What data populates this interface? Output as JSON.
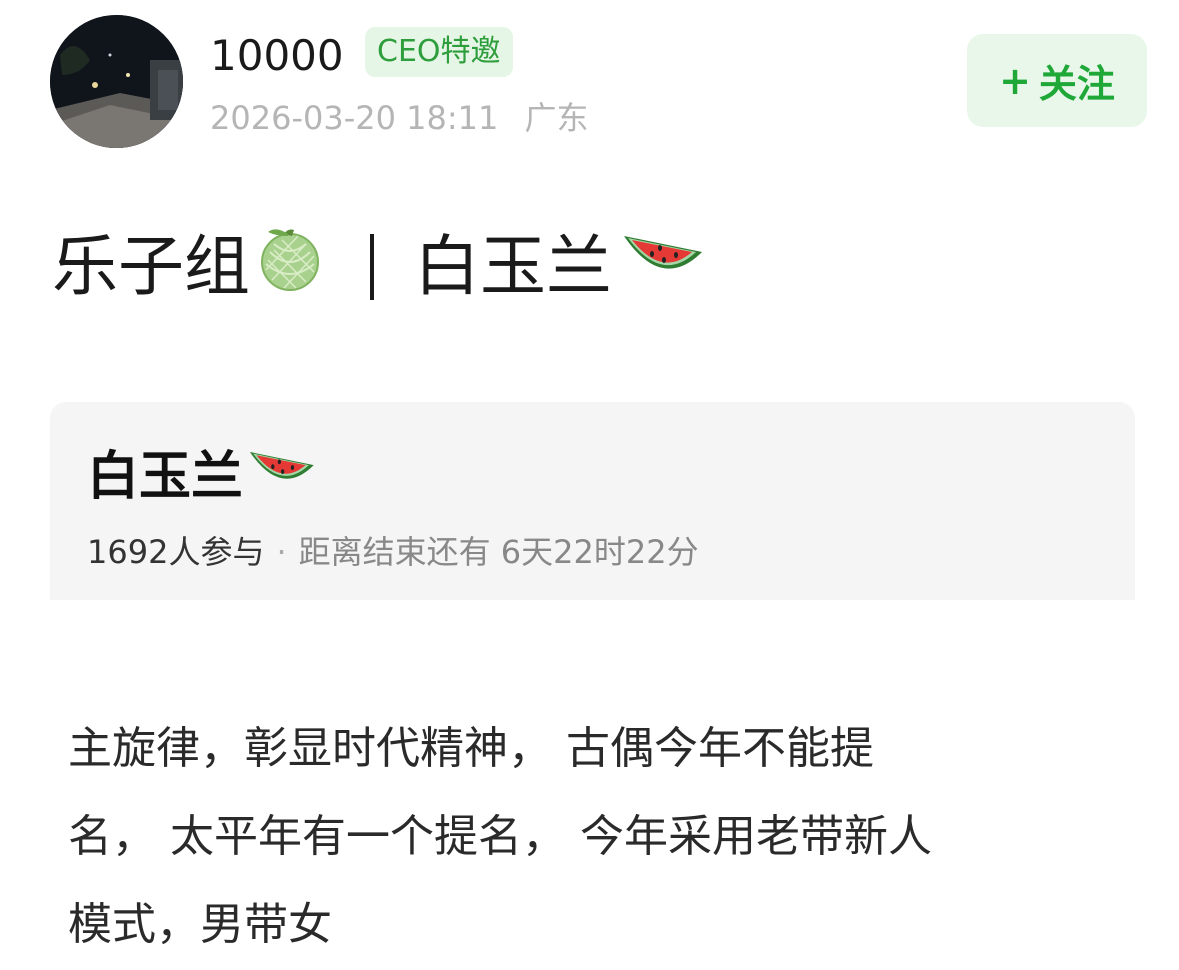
{
  "header": {
    "username": "10000",
    "badge": "CEO特邀",
    "timestamp": "2026-03-20 18:11",
    "location": "广东",
    "follow_label": "关注",
    "follow_icon": "plus-icon"
  },
  "post": {
    "title_part1": "乐子组",
    "title_icon1": "melon-emoji",
    "title_part2": "白玉兰",
    "title_icon2": "watermelon-emoji",
    "body_lines": [
      "主旋律，彰显时代精神， 古偶今年不能提",
      "名， 太平年有一个提名， 今年采用老带新人",
      "模式，男带女"
    ]
  },
  "poll": {
    "title": "白玉兰",
    "title_icon": "watermelon-emoji",
    "participants": "1692人参与",
    "separator": "·",
    "countdown": "距离结束还有 6天22时22分"
  },
  "colors": {
    "accent_green": "#1fa838",
    "badge_bg": "#e6f6e6",
    "card_bg": "#f5f5f5",
    "muted_text": "#b5b5b5"
  }
}
